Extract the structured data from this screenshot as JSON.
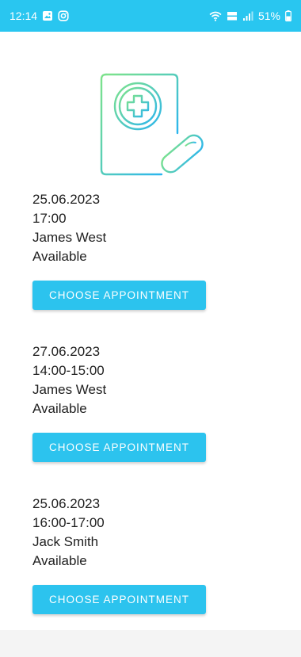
{
  "status_bar": {
    "time": "12:14",
    "battery": "51%",
    "icons": [
      "gallery-icon",
      "instagram-icon",
      "wifi-icon",
      "volte-icon",
      "signal-icon",
      "battery-icon"
    ]
  },
  "hero": {
    "icon": "medical-prescription-icon"
  },
  "appointments": [
    {
      "date": "25.06.2023",
      "time": "17:00",
      "doctor": "James West",
      "status": "Available",
      "button_label": "CHOOSE APPOINTMENT"
    },
    {
      "date": "27.06.2023",
      "time": "14:00-15:00",
      "doctor": "James West",
      "status": "Available",
      "button_label": "CHOOSE APPOINTMENT"
    },
    {
      "date": "25.06.2023",
      "time": "16:00-17:00",
      "doctor": "Jack Smith",
      "status": "Available",
      "button_label": "CHOOSE APPOINTMENT"
    }
  ],
  "colors": {
    "status_bar": "#29c6f0",
    "button": "#2cc3ee",
    "icon_gradient_start": "#7ee38a",
    "icon_gradient_end": "#2bb5ee"
  }
}
